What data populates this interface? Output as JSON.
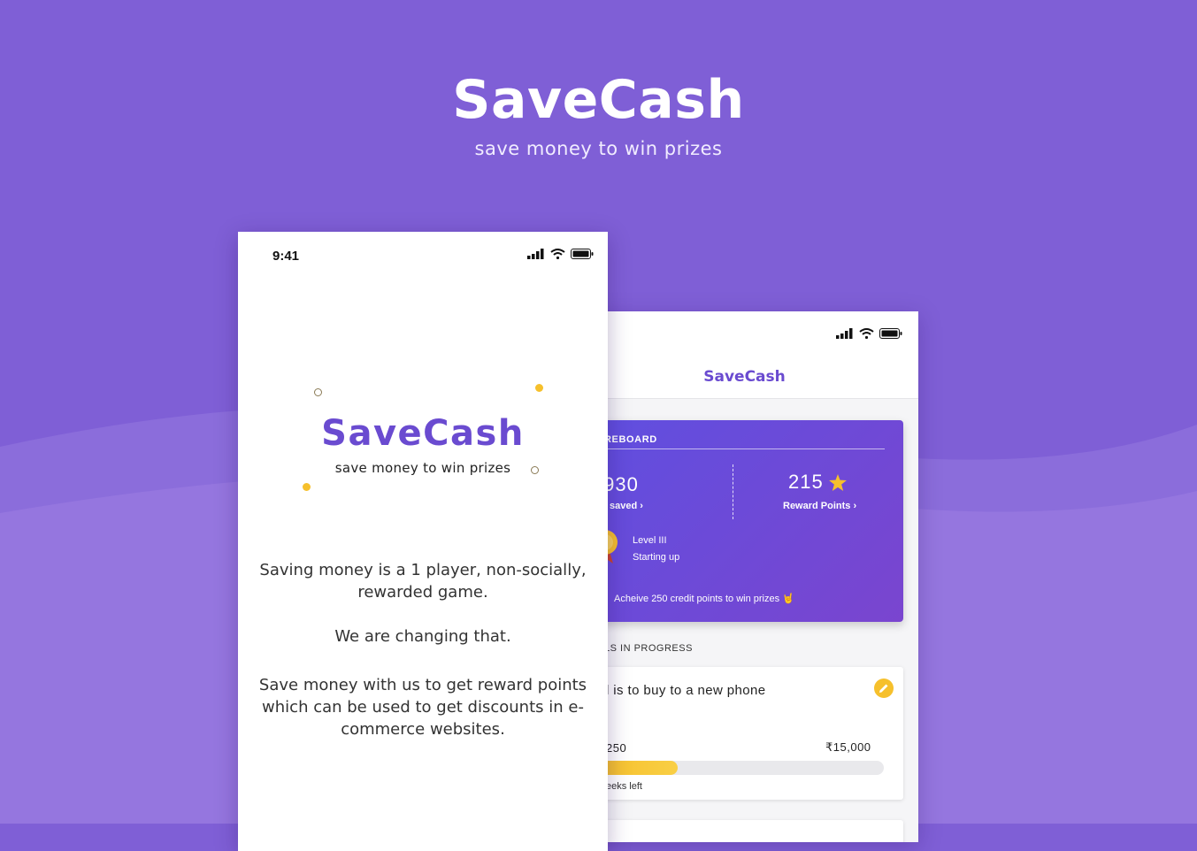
{
  "colors": {
    "brand": "#7f5fd6",
    "accent": "#6a4bd0",
    "gold": "#f6c02c"
  },
  "hero": {
    "title": "SaveCash",
    "subtitle": "save money to win prizes"
  },
  "splash": {
    "time": "9:41",
    "logo": "SaveCash",
    "tagline": "save money to win prizes",
    "para1": "Saving money is a 1 player, non-socially, rewarded game.",
    "para2": "We are changing that.",
    "para3": "Save money with us to get reward points which can be used to get discounts in e-commerce websites."
  },
  "dashboard": {
    "app_title": "SaveCash",
    "scoreboard": {
      "label": "REBOARD",
      "amount": ",930",
      "saved_label": "saved ›",
      "points": "215",
      "points_icon": "star-icon",
      "points_label": "Reward Points ›",
      "level": "Level III",
      "level_status": "Starting up",
      "tip": "Acheive 250 credit points to win prizes 🤘"
    },
    "section_label": "LS IN PROGRESS",
    "goal": {
      "title": "l is to buy to a new phone",
      "current": "250",
      "target": "₹15,000",
      "progress": 0.28,
      "time_left": "eeks left"
    }
  }
}
